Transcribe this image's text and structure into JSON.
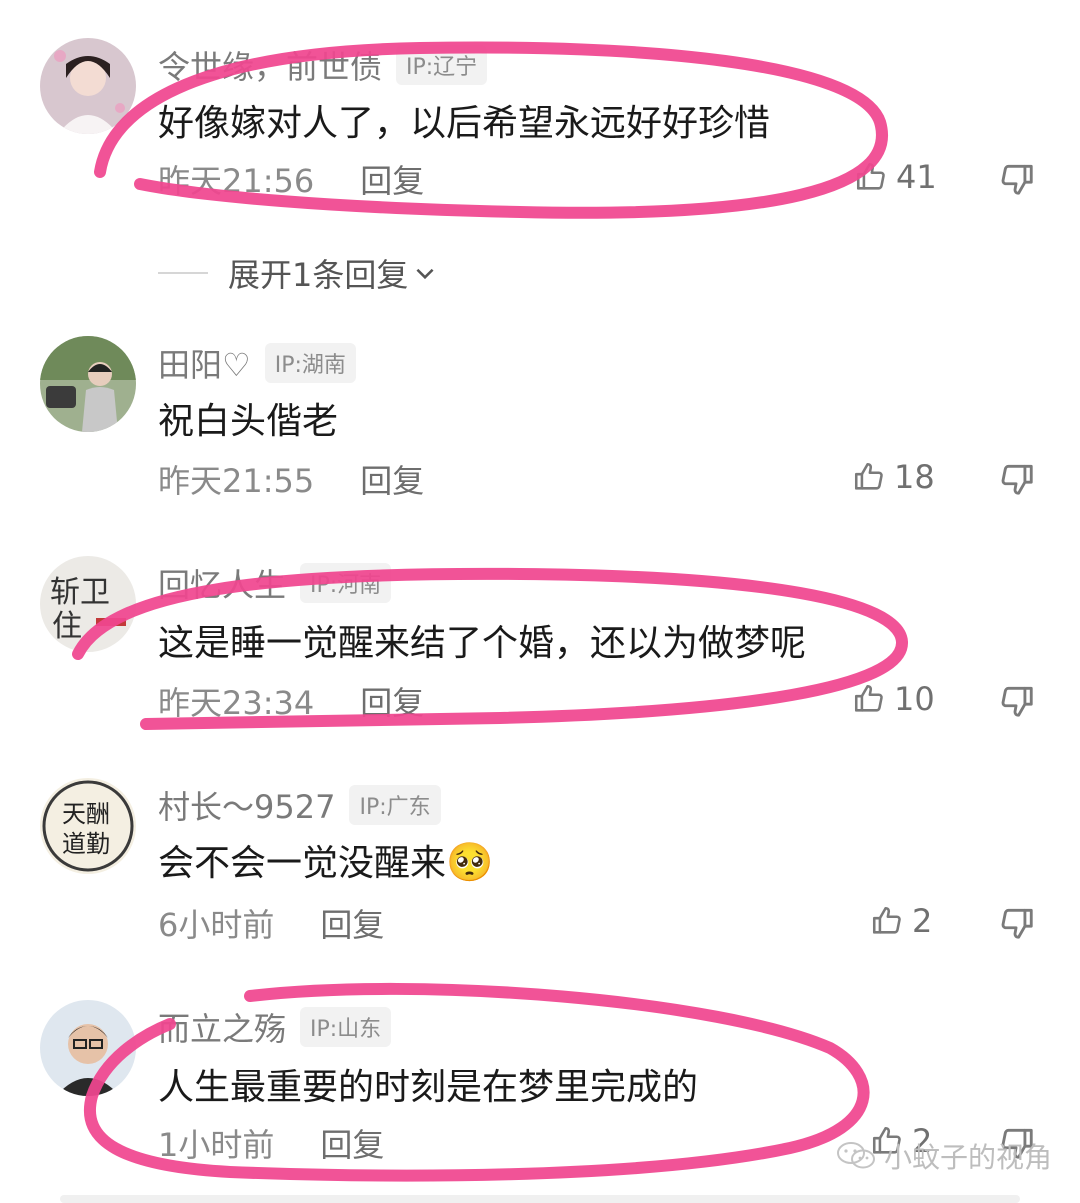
{
  "comments": [
    {
      "name": "令世缘，前世债",
      "ip": "IP:辽宁",
      "text": "好像嫁对人了，以后希望永远好好珍惜",
      "time": "昨天21:56",
      "reply": "回复",
      "likes": "41"
    },
    {
      "name": "田阳♡",
      "ip": "IP:湖南",
      "text": "祝白头偕老",
      "time": "昨天21:55",
      "reply": "回复",
      "likes": "18"
    },
    {
      "name": "回忆人生",
      "ip": "IP:河南",
      "text": "这是睡一觉醒来结了个婚，还以为做梦呢",
      "time": "昨天23:34",
      "reply": "回复",
      "likes": "10"
    },
    {
      "name": "村长～9527",
      "ip": "IP:广东",
      "text": "会不会一觉没醒来",
      "emoji": "🥺",
      "time": "6小时前",
      "reply": "回复",
      "likes": "2"
    },
    {
      "name": "而立之殇",
      "ip": "IP:山东",
      "text": "人生最重要的时刻是在梦里完成的",
      "time": "1小时前",
      "reply": "回复",
      "likes": "2"
    }
  ],
  "expand": {
    "label": "展开1条回复"
  },
  "watermark": {
    "text": "小蚊子的视角"
  },
  "colors": {
    "highlight": "#f0468f",
    "icon": "#7a7a7a"
  }
}
